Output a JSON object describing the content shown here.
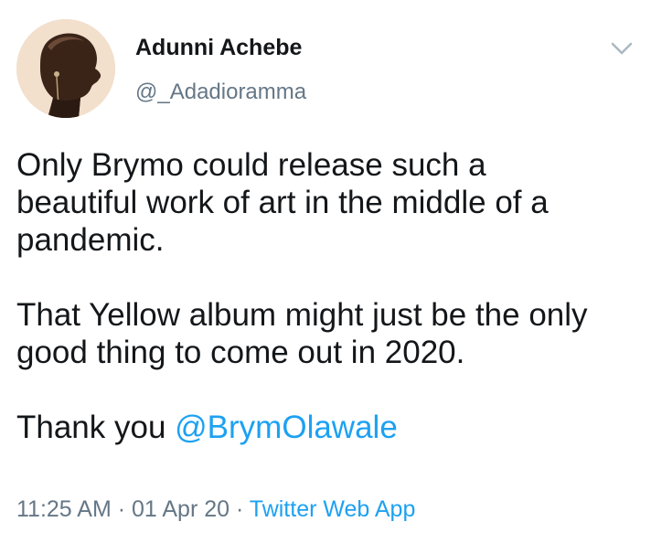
{
  "tweet": {
    "author": {
      "display_name": "Adunni Achebe",
      "handle": "@_Adadioramma"
    },
    "text_lines": [
      "Only Brymo could release such a",
      "beautiful work of art in the middle of a",
      "pandemic.",
      "That Yellow album might just be the only",
      "good thing to come out in 2020.",
      "Thank you "
    ],
    "mention": "@BrymOlawale",
    "time": "11:25 AM",
    "separator": " · ",
    "date": "01 Apr 20",
    "source": "Twitter Web App"
  },
  "colors": {
    "accent": "#1da1f2",
    "secondary_text": "#657786",
    "primary_text": "#14171a",
    "caret": "#aab8c2"
  }
}
